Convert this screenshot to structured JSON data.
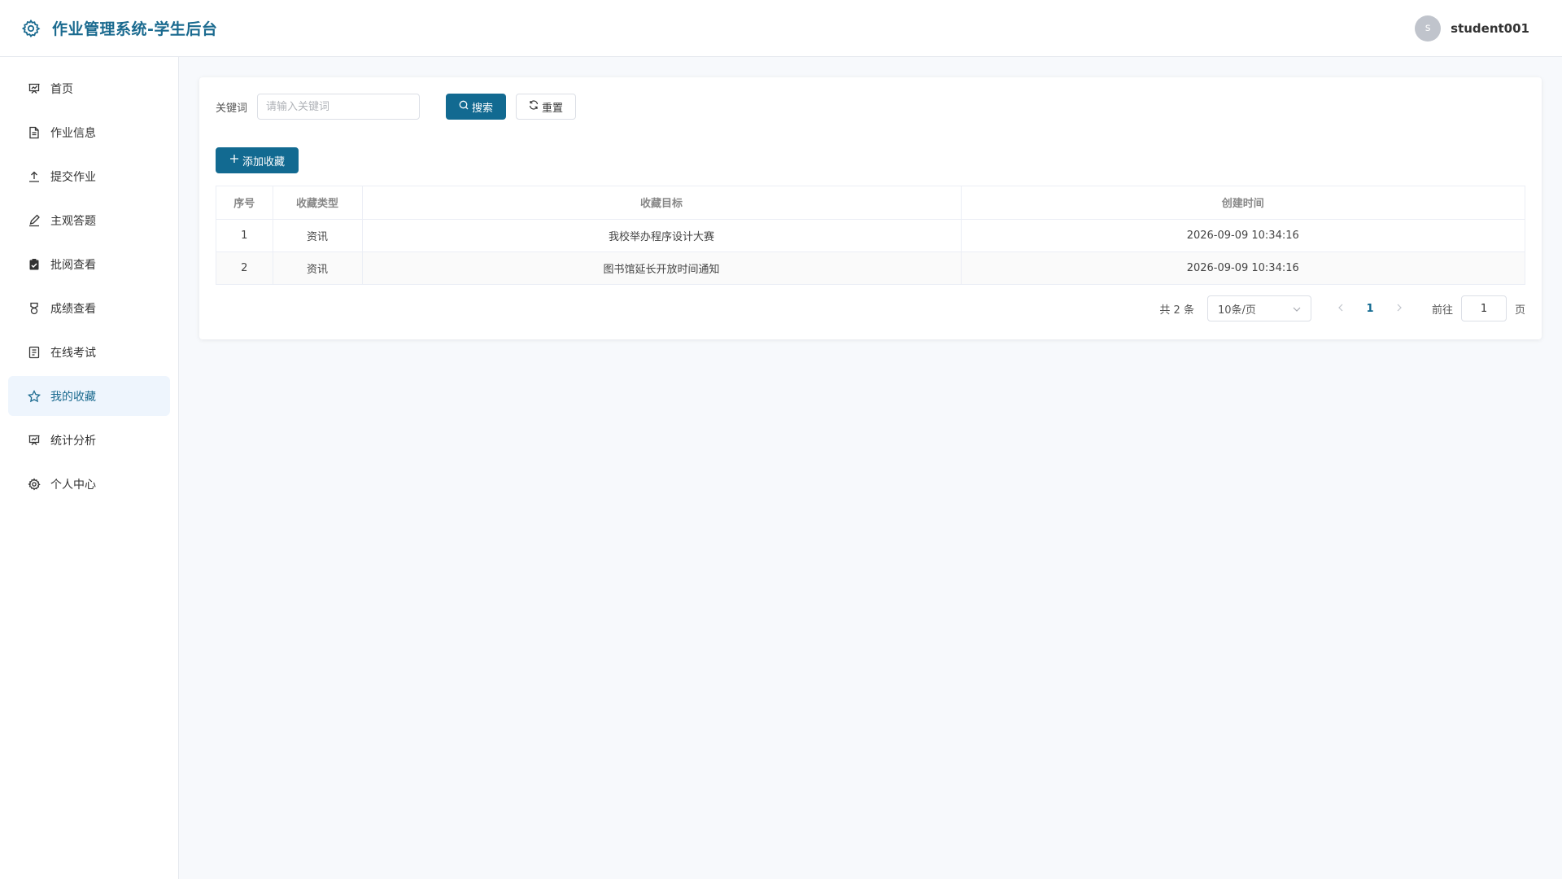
{
  "header": {
    "title": "作业管理系统-学生后台",
    "logo_icon": "gear-icon",
    "user": {
      "avatar_letter": "s",
      "name": "student001"
    }
  },
  "sidebar": {
    "items": [
      {
        "label": "首页",
        "icon": "presentation-icon"
      },
      {
        "label": "作业信息",
        "icon": "document-icon"
      },
      {
        "label": "提交作业",
        "icon": "upload-icon"
      },
      {
        "label": "主观答题",
        "icon": "edit-pen-icon"
      },
      {
        "label": "批阅查看",
        "icon": "clipboard-check-icon"
      },
      {
        "label": "成绩查看",
        "icon": "medal-icon"
      },
      {
        "label": "在线考试",
        "icon": "tickets-icon"
      },
      {
        "label": "我的收藏",
        "icon": "star-icon"
      },
      {
        "label": "统计分析",
        "icon": "presentation-icon"
      },
      {
        "label": "个人中心",
        "icon": "gear-icon"
      }
    ],
    "active_index": 7
  },
  "search": {
    "label": "关键词",
    "placeholder": "请输入关键词",
    "value": "",
    "search_label": "搜索",
    "reset_label": "重置"
  },
  "toolbar": {
    "add_label": "添加收藏"
  },
  "table": {
    "columns": [
      "序号",
      "收藏类型",
      "收藏目标",
      "创建时间"
    ],
    "rows": [
      [
        "1",
        "资讯",
        "我校举办程序设计大赛",
        "2026-09-09 10:34:16"
      ],
      [
        "2",
        "资讯",
        "图书馆延长开放时间通知",
        "2026-09-09 10:34:16"
      ]
    ]
  },
  "pagination": {
    "total_text": "共 2 条",
    "page_size": "10条/页",
    "current_page": "1",
    "goto_label": "前往",
    "goto_value": "1",
    "page_unit": "页"
  },
  "colors": {
    "primary": "#126a91",
    "brand_text": "#1a6a8f",
    "active_bg": "#eef5fd"
  }
}
